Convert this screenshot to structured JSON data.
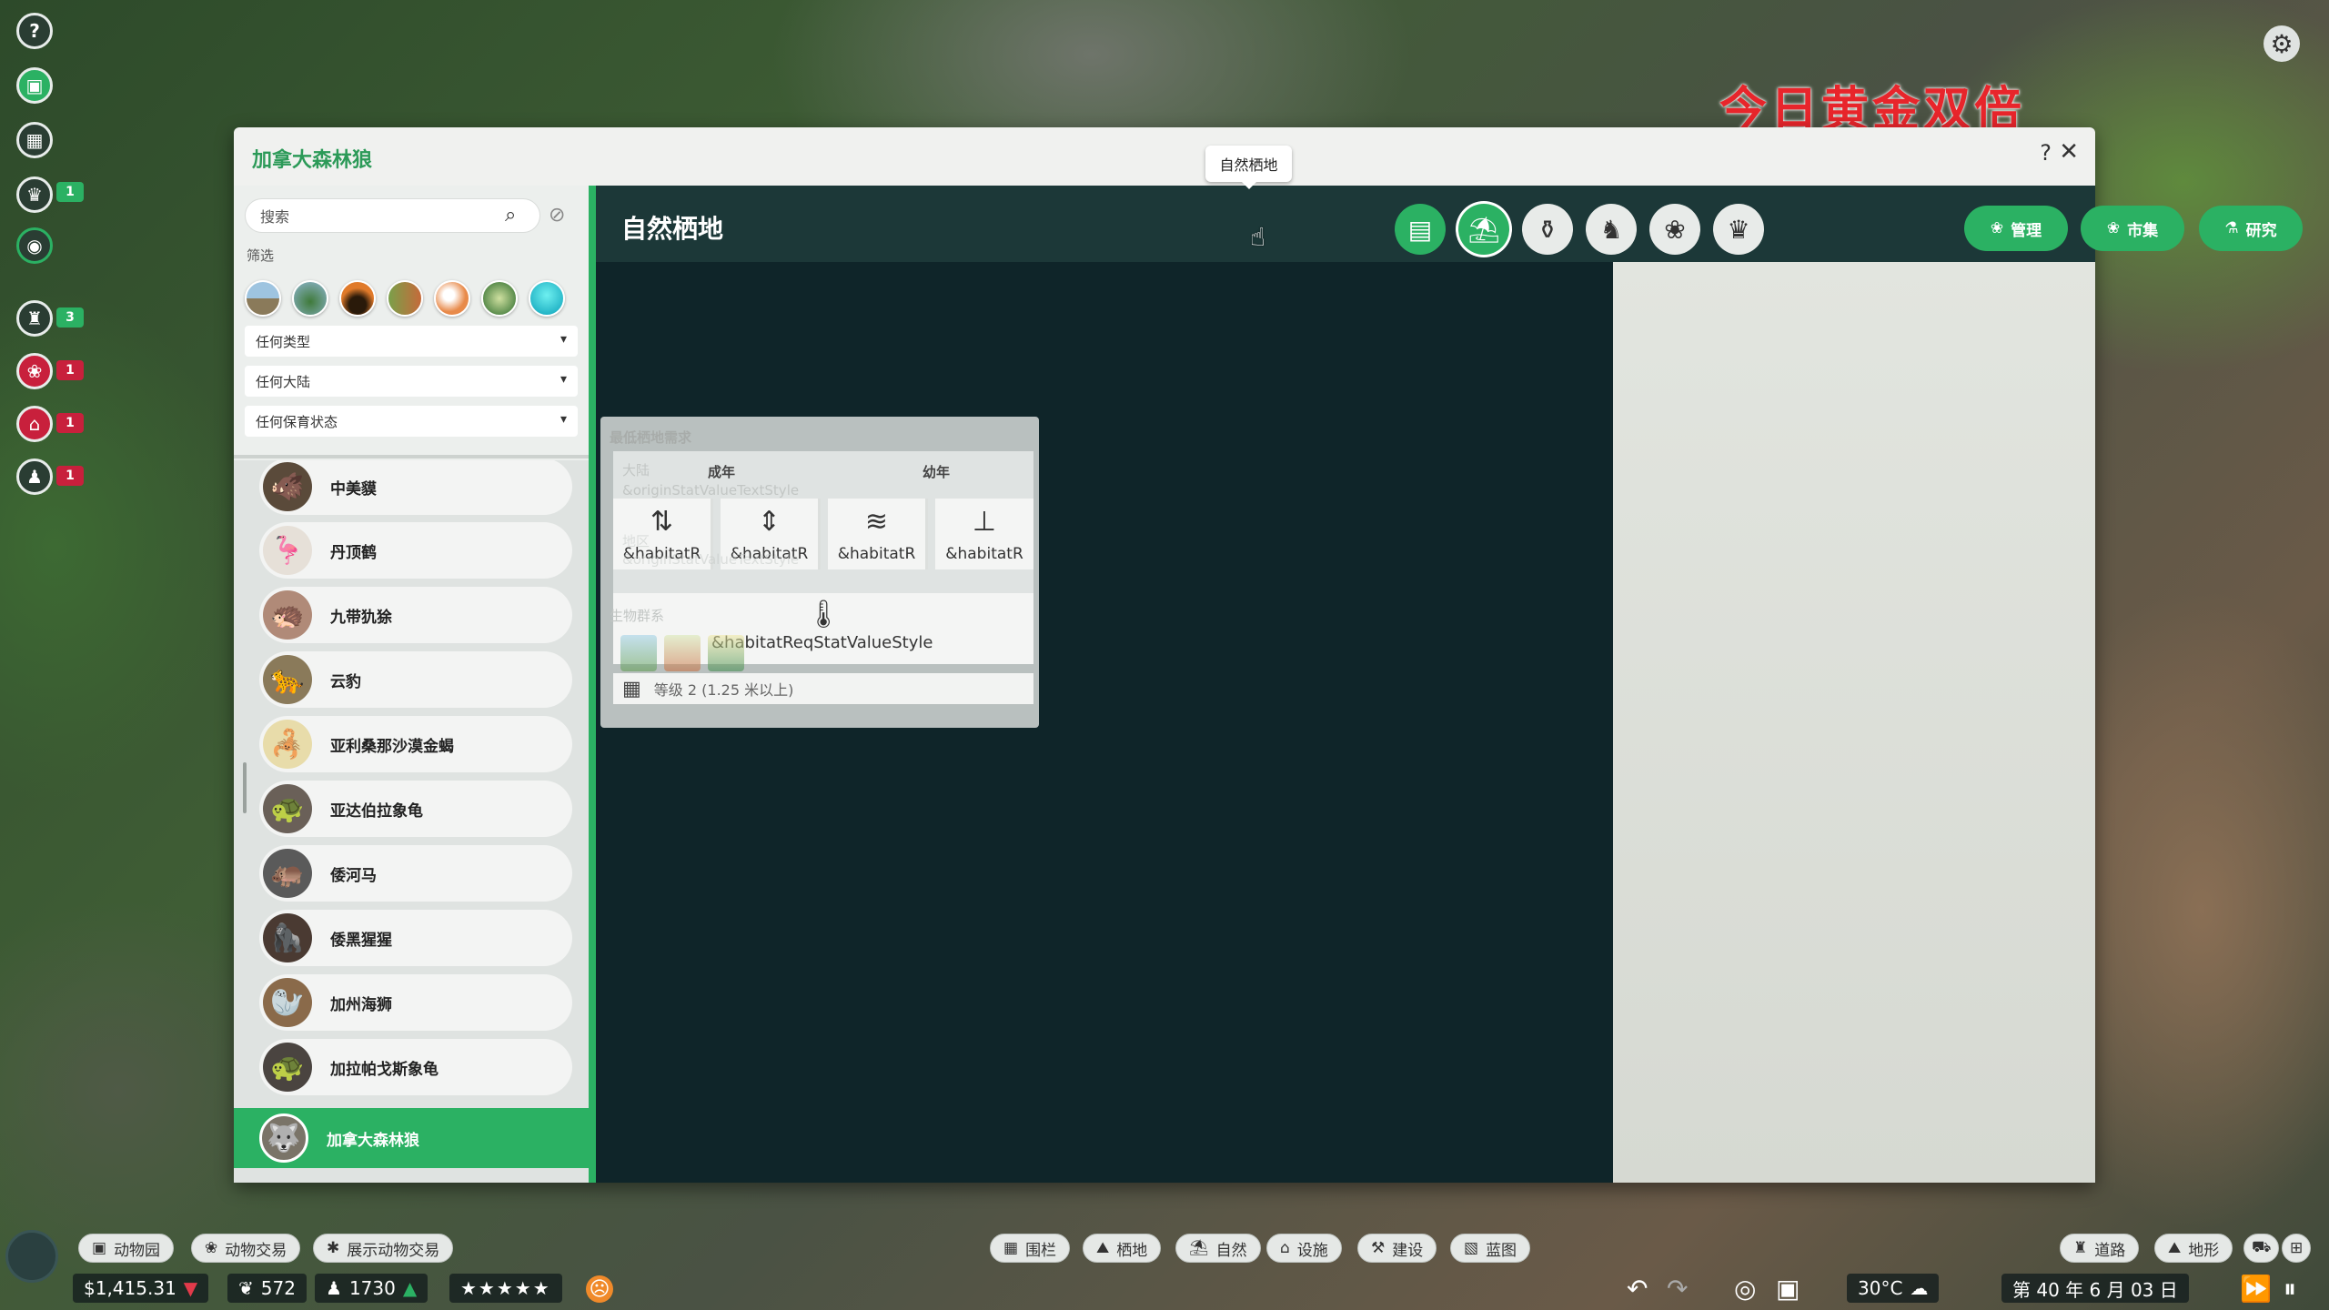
{
  "banner": "今日黄金双倍",
  "rail": {
    "badges": [
      "1",
      "3",
      "1",
      "1",
      "1"
    ]
  },
  "window": {
    "title": "加拿大森林狼",
    "help": "?",
    "close": "✕"
  },
  "sidebar": {
    "search_placeholder": "搜索",
    "filter_label": "筛选",
    "dropdowns": [
      "任何类型",
      "任何大陆",
      "任何保育状态"
    ],
    "animals": [
      "中美貘",
      "丹顶鹤",
      "九带犰狳",
      "云豹",
      "亚利桑那沙漠金蝎",
      "亚达伯拉象龟",
      "倭河马",
      "倭黑猩猩",
      "加州海狮",
      "加拉帕戈斯象龟",
      "加拿大森林狼"
    ]
  },
  "header": {
    "title": "自然栖地",
    "tooltip": "自然栖地",
    "pills": [
      "管理",
      "市集",
      "研究"
    ]
  },
  "requirements": {
    "title": "最低栖地需求",
    "continent_label": "大陆",
    "origin_placeholder": "&originStatValueTextStyle",
    "adult": "成年",
    "juvenile": "幼年",
    "region_label": "地区",
    "origin_placeholder2": "&originStatValueTextStyle",
    "stats": [
      "&habitatR",
      "&habitatR",
      "&habitatR",
      "&habitatR"
    ],
    "biome_label": "生物群系",
    "temp_value": "&habitatReqStatValueStyle",
    "fence": "等级 2 (1.25 米以上)"
  },
  "bottom": {
    "left_buttons": [
      "动物园",
      "动物交易",
      "展示动物交易"
    ],
    "center_buttons": [
      "围栏",
      "栖地",
      "自然",
      "设施",
      "建设",
      "蓝图"
    ],
    "right_buttons": [
      "道路",
      "地形"
    ],
    "money": "$1,415.31",
    "conservation": "572",
    "guests": "1730",
    "temperature": "30°C",
    "date": "第 40 年 6 月 03 日"
  },
  "colors": {
    "accent": "#2bb163",
    "dark": "#1c3838",
    "badge_red": "#c8203c"
  }
}
